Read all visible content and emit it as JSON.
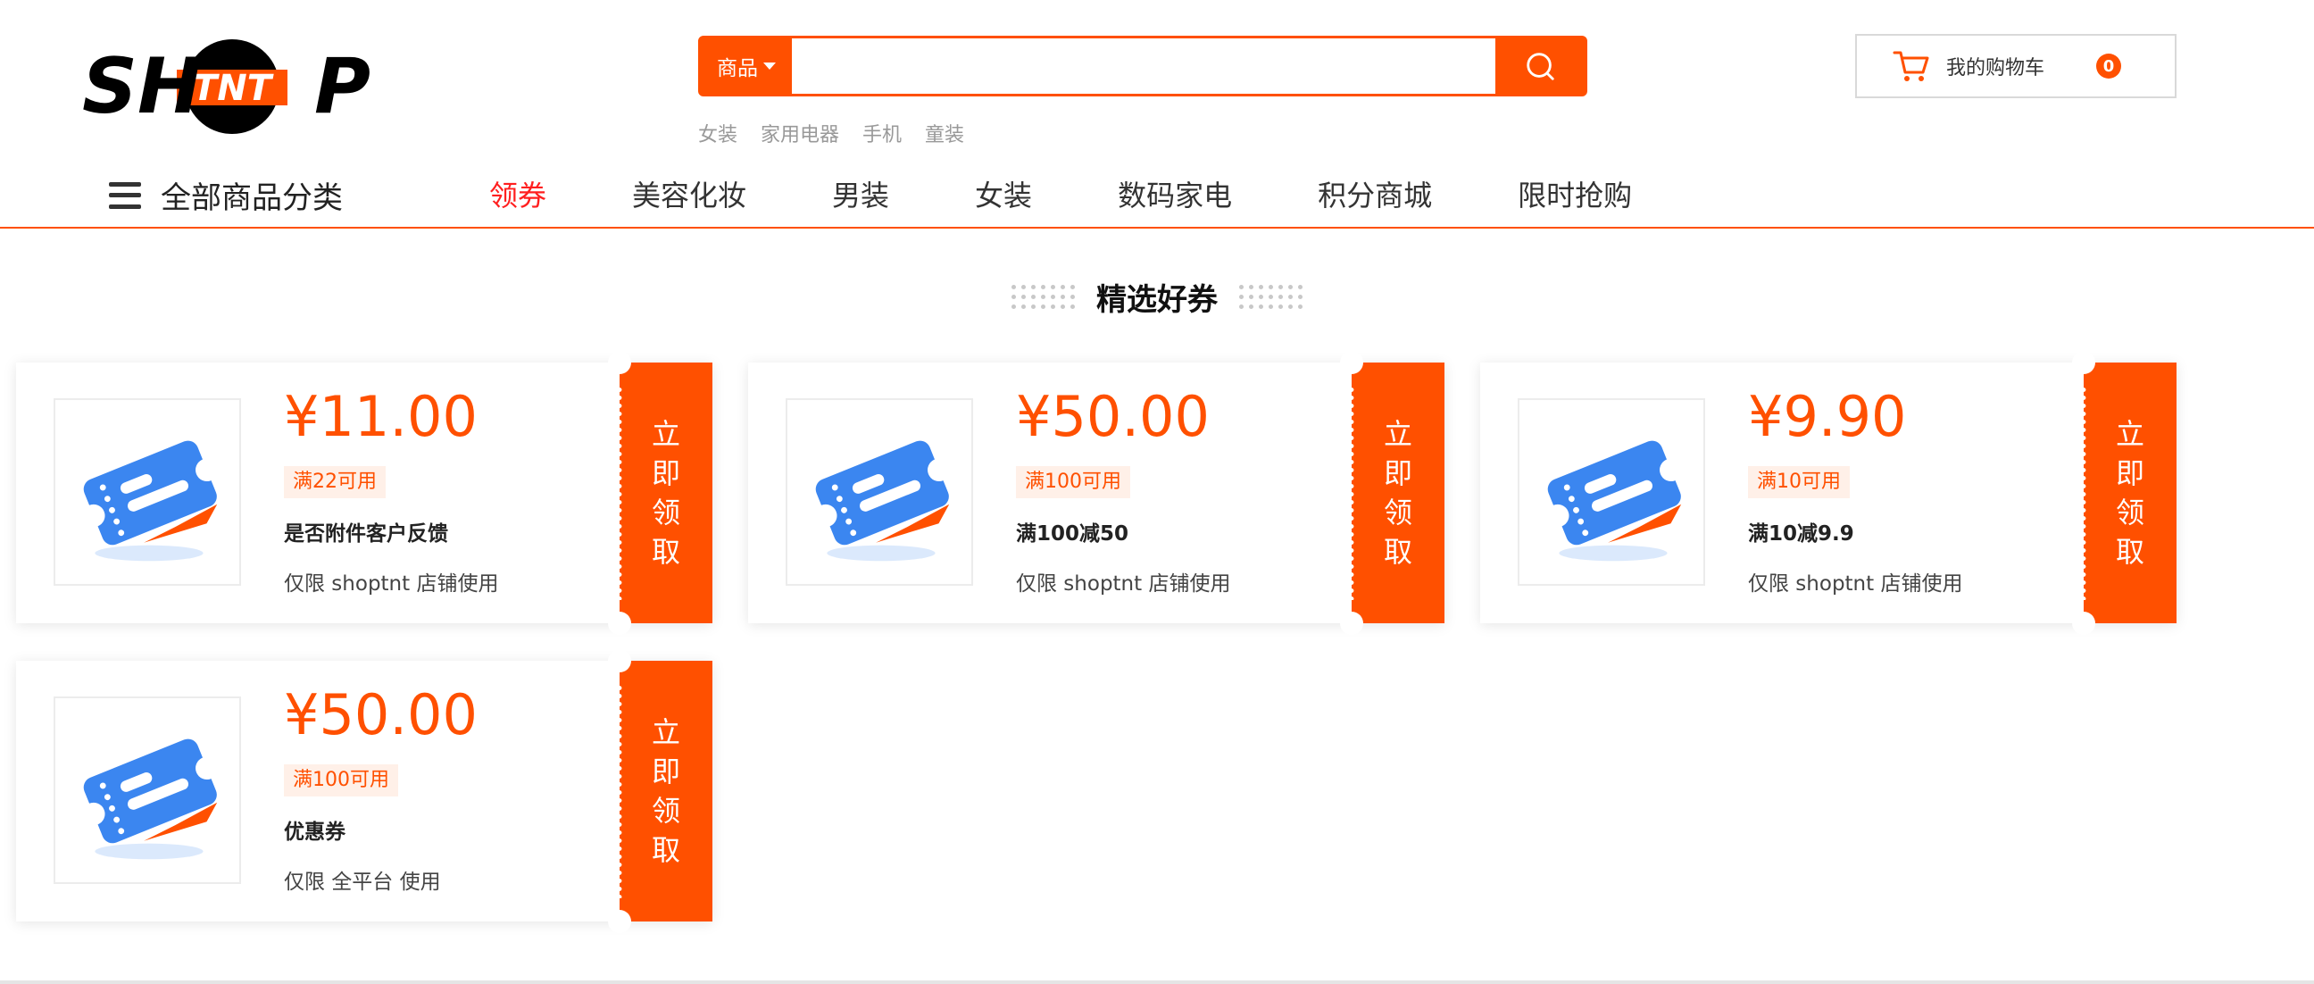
{
  "logo": {
    "text": "SHTNTP"
  },
  "search": {
    "category_label": "商品",
    "placeholder": "",
    "value": ""
  },
  "hot_words": [
    "女装",
    "家用电器",
    "手机",
    "童装"
  ],
  "cart": {
    "label": "我的购物车",
    "count": "0"
  },
  "nav": {
    "all_categories": "全部商品分类",
    "links": [
      "领券",
      "美容化妆",
      "男装",
      "女装",
      "数码家电",
      "积分商城",
      "限时抢购"
    ],
    "active_index": 0
  },
  "section": {
    "title": "精选好券"
  },
  "coupons": [
    {
      "amount": "¥11.00",
      "condition": "满22可用",
      "name": "是否附件客户反馈",
      "scope": "仅限 shoptnt 店铺使用",
      "button": "立即领取"
    },
    {
      "amount": "¥50.00",
      "condition": "满100可用",
      "name": "满100减50",
      "scope": "仅限 shoptnt 店铺使用",
      "button": "立即领取"
    },
    {
      "amount": "¥9.90",
      "condition": "满10可用",
      "name": "满10减9.9",
      "scope": "仅限 shoptnt 店铺使用",
      "button": "立即领取"
    },
    {
      "amount": "¥50.00",
      "condition": "满100可用",
      "name": "优惠券",
      "scope": "仅限 全平台 使用",
      "button": "立即领取"
    }
  ],
  "colors": {
    "accent": "#ff5000",
    "active_nav": "#ff1f1f",
    "ticket_blue": "#3b86f0"
  },
  "icons": {
    "search": "search-icon",
    "cart": "cart-icon",
    "menu": "hamburger-icon",
    "coupon": "ticket-icon"
  }
}
